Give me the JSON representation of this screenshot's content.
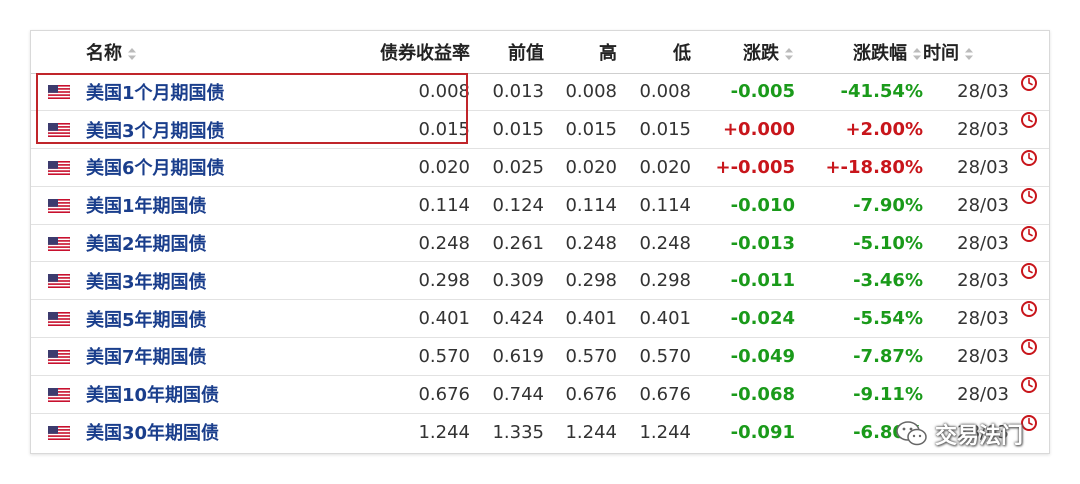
{
  "colors": {
    "link": "#1a3e8c",
    "up": "#c8151b",
    "down": "#1a9a1a",
    "highlight": "#c0252a"
  },
  "header": {
    "name": "名称",
    "yield": "债券收益率",
    "prev": "前值",
    "high": "高",
    "low": "低",
    "change": "涨跌",
    "change_pct": "涨跌幅",
    "time": "时间"
  },
  "rows": [
    {
      "name": "美国1个月期国债",
      "yield": "0.008",
      "prev": "0.013",
      "high": "0.008",
      "low": "0.008",
      "change": "-0.005",
      "change_pct": "-41.54%",
      "time": "28/03",
      "dir": "down"
    },
    {
      "name": "美国3个月期国债",
      "yield": "0.015",
      "prev": "0.015",
      "high": "0.015",
      "low": "0.015",
      "change": "+0.000",
      "change_pct": "+2.00%",
      "time": "28/03",
      "dir": "up"
    },
    {
      "name": "美国6个月期国债",
      "yield": "0.020",
      "prev": "0.025",
      "high": "0.020",
      "low": "0.020",
      "change": "+-0.005",
      "change_pct": "+-18.80%",
      "time": "28/03",
      "dir": "up"
    },
    {
      "name": "美国1年期国债",
      "yield": "0.114",
      "prev": "0.124",
      "high": "0.114",
      "low": "0.114",
      "change": "-0.010",
      "change_pct": "-7.90%",
      "time": "28/03",
      "dir": "down"
    },
    {
      "name": "美国2年期国债",
      "yield": "0.248",
      "prev": "0.261",
      "high": "0.248",
      "low": "0.248",
      "change": "-0.013",
      "change_pct": "-5.10%",
      "time": "28/03",
      "dir": "down"
    },
    {
      "name": "美国3年期国债",
      "yield": "0.298",
      "prev": "0.309",
      "high": "0.298",
      "low": "0.298",
      "change": "-0.011",
      "change_pct": "-3.46%",
      "time": "28/03",
      "dir": "down"
    },
    {
      "name": "美国5年期国债",
      "yield": "0.401",
      "prev": "0.424",
      "high": "0.401",
      "low": "0.401",
      "change": "-0.024",
      "change_pct": "-5.54%",
      "time": "28/03",
      "dir": "down"
    },
    {
      "name": "美国7年期国债",
      "yield": "0.570",
      "prev": "0.619",
      "high": "0.570",
      "low": "0.570",
      "change": "-0.049",
      "change_pct": "-7.87%",
      "time": "28/03",
      "dir": "down"
    },
    {
      "name": "美国10年期国债",
      "yield": "0.676",
      "prev": "0.744",
      "high": "0.676",
      "low": "0.676",
      "change": "-0.068",
      "change_pct": "-9.11%",
      "time": "28/03",
      "dir": "down"
    },
    {
      "name": "美国30年期国债",
      "yield": "1.244",
      "prev": "1.335",
      "high": "1.244",
      "low": "1.244",
      "change": "-0.091",
      "change_pct": "-6.80%",
      "time": "28/03",
      "dir": "down"
    }
  ],
  "watermark": {
    "text": "交易法门",
    "icon": "wechat-icon"
  }
}
